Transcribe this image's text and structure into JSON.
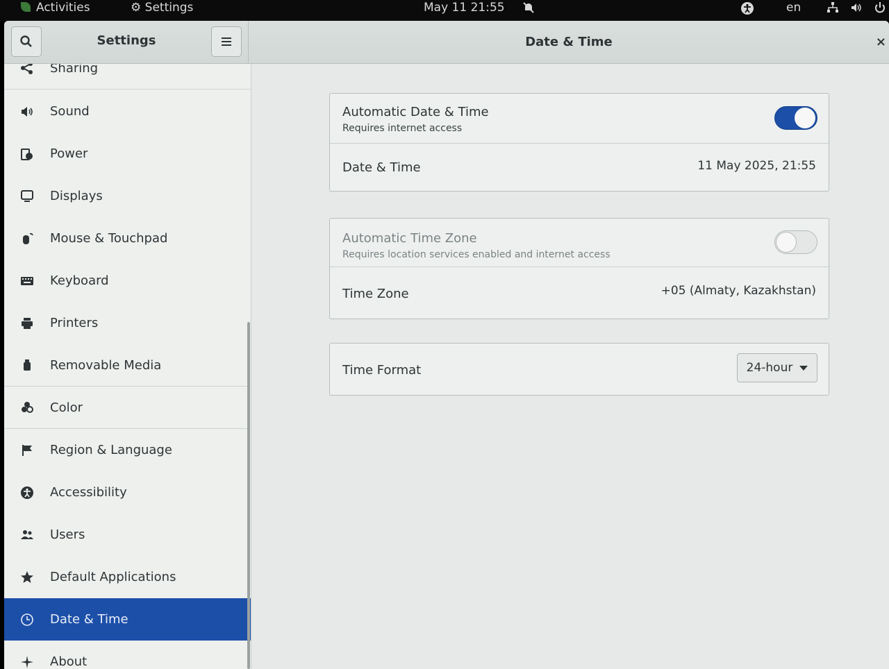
{
  "topbar": {
    "activities": "Activities",
    "app_name": "Settings",
    "clock": "May 11  21:55",
    "language": "en"
  },
  "header": {
    "sidebar_title": "Settings",
    "page_title": "Date & Time"
  },
  "sidebar": {
    "items": [
      {
        "label": "Sharing",
        "icon": "share-icon"
      },
      {
        "label": "Sound",
        "icon": "speaker-icon"
      },
      {
        "label": "Power",
        "icon": "power-plug-icon"
      },
      {
        "label": "Displays",
        "icon": "display-icon"
      },
      {
        "label": "Mouse & Touchpad",
        "icon": "mouse-icon"
      },
      {
        "label": "Keyboard",
        "icon": "keyboard-icon"
      },
      {
        "label": "Printers",
        "icon": "printer-icon"
      },
      {
        "label": "Removable Media",
        "icon": "usb-drive-icon"
      },
      {
        "label": "Color",
        "icon": "color-icon"
      },
      {
        "label": "Region & Language",
        "icon": "flag-icon"
      },
      {
        "label": "Accessibility",
        "icon": "accessibility-icon"
      },
      {
        "label": "Users",
        "icon": "users-icon"
      },
      {
        "label": "Default Applications",
        "icon": "star-icon"
      },
      {
        "label": "Date & Time",
        "icon": "clock-icon",
        "active": true
      },
      {
        "label": "About",
        "icon": "sparkle-icon"
      }
    ]
  },
  "datetime": {
    "auto_datetime": {
      "title": "Automatic Date & Time",
      "subtitle": "Requires internet access",
      "enabled": true
    },
    "date_time": {
      "title": "Date & Time",
      "value": "11 May 2025, 21:55"
    },
    "auto_timezone": {
      "title": "Automatic Time Zone",
      "subtitle": "Requires location services enabled and internet access",
      "enabled": false
    },
    "time_zone": {
      "title": "Time Zone",
      "value": "+05 (Almaty, Kazakhstan)"
    },
    "time_format": {
      "title": "Time Format",
      "selected": "24-hour"
    }
  },
  "colors": {
    "accent": "#1c4fa8",
    "window_bg": "#e9ecea",
    "topbar_bg": "#0b0b0b"
  }
}
